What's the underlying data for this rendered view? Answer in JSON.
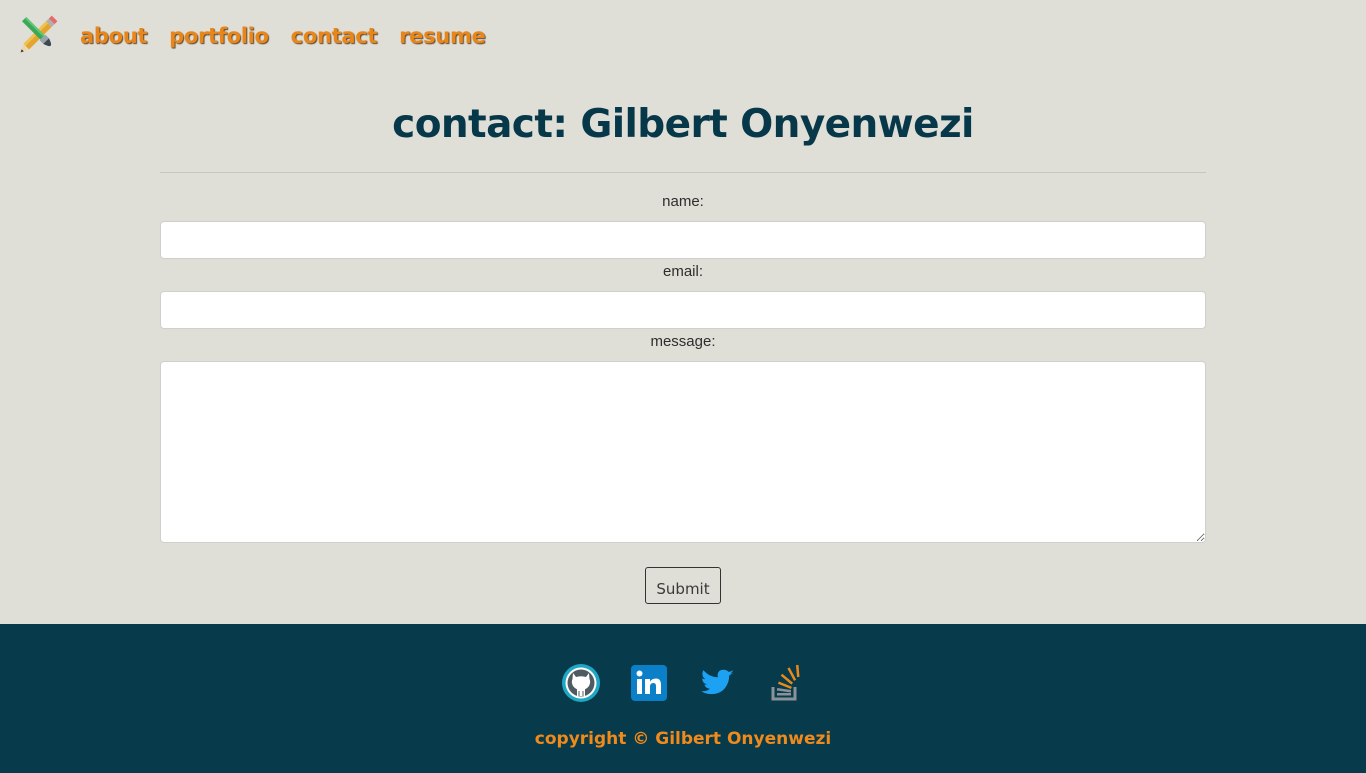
{
  "nav": {
    "logo_icon": "pencil-brush-crossed-icon",
    "links": [
      {
        "label": "about"
      },
      {
        "label": "portfolio"
      },
      {
        "label": "contact"
      },
      {
        "label": "resume"
      }
    ],
    "link_color": "#e9861a"
  },
  "main": {
    "title": "contact: Gilbert Onyenwezi",
    "title_color": "#07384a",
    "form": {
      "name_label": "name:",
      "name_value": "",
      "email_label": "email:",
      "email_value": "",
      "message_label": "message:",
      "message_value": "",
      "submit_label": "Submit"
    }
  },
  "footer": {
    "background": "#073a4b",
    "social_icons": [
      "github-icon",
      "linkedin-icon",
      "twitter-icon",
      "stackoverflow-icon"
    ],
    "copyright": "copyright © Gilbert Onyenwezi",
    "copyright_color": "#f08a1a"
  },
  "page_background": "#dfded7"
}
